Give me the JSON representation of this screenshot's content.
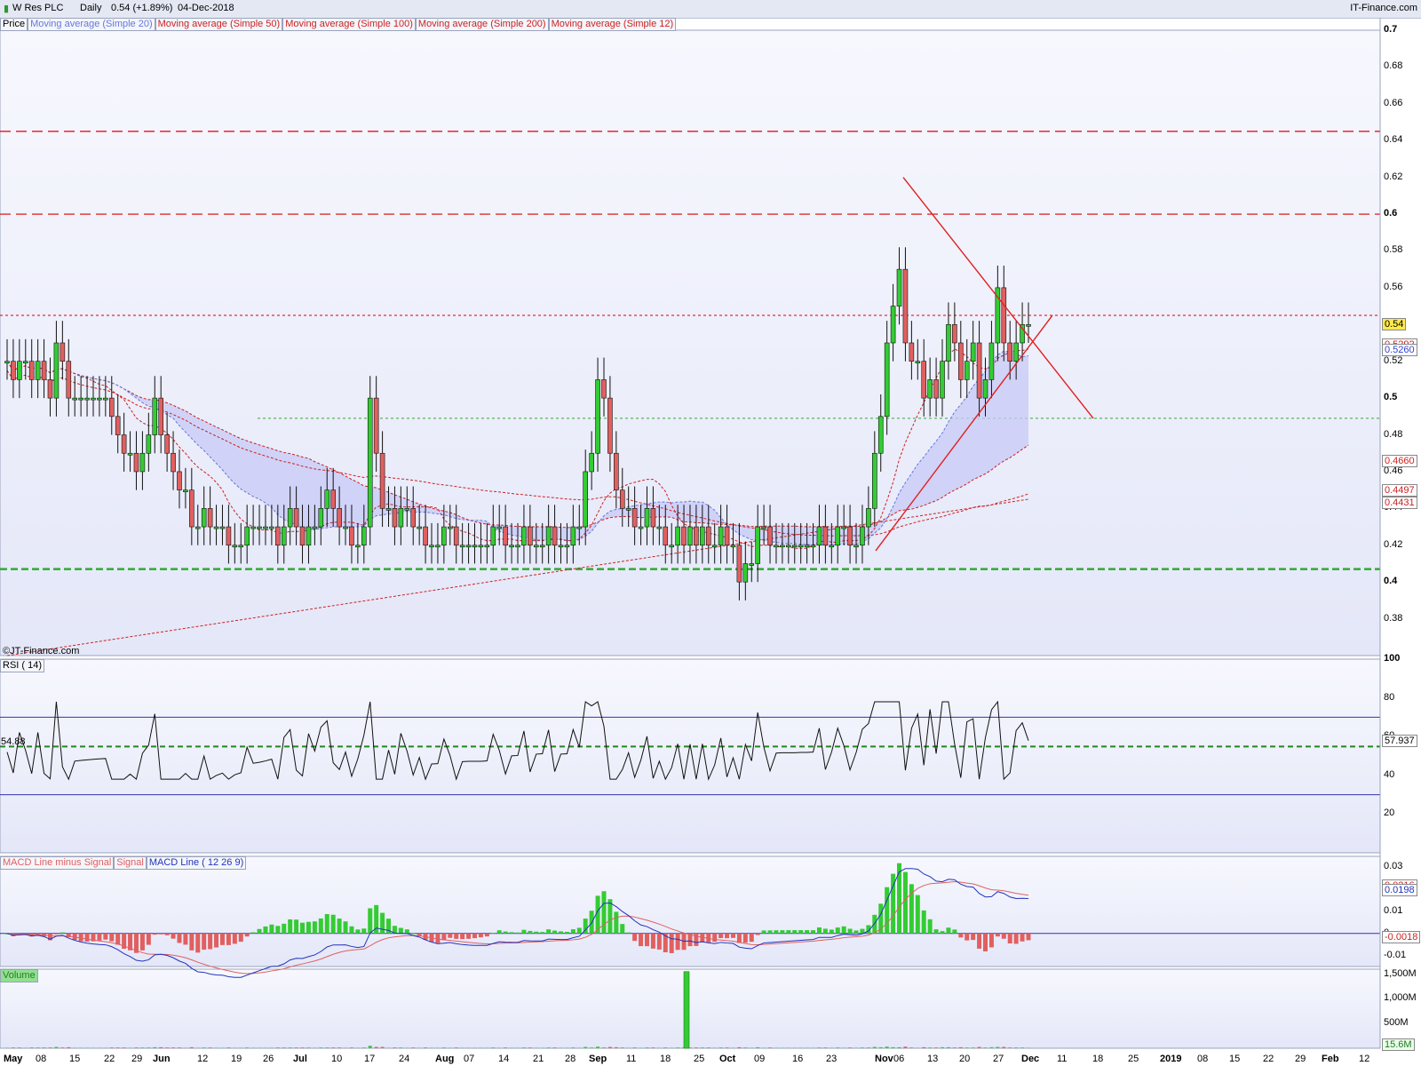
{
  "header": {
    "ticker": "W Res PLC",
    "period": "Daily",
    "quote": "0.54 (+1.89%)",
    "date": "04-Dec-2018",
    "brand": "IT-Finance.com"
  },
  "watermark": "©JT-Finance.com",
  "price_panel": {
    "legend": [
      "Price",
      "Moving average (Simple 20)",
      "Moving average (Simple 50)",
      "Moving average (Simple 100)",
      "Moving average (Simple 200)",
      "Moving average (Simple 12)"
    ],
    "y_ticks": [
      "0.7",
      "0.68",
      "0.66",
      "0.64",
      "0.62",
      "0.6",
      "0.58",
      "0.56",
      "0.54",
      "0.52",
      "0.5",
      "0.48",
      "0.46",
      "0.44",
      "0.42",
      "0.4",
      "0.38"
    ],
    "tags": [
      "0.54",
      "0.5292",
      "0.5260",
      "0.4660",
      "0.4497",
      "0.4431"
    ]
  },
  "rsi_panel": {
    "legend": "RSI ( 14)",
    "y_ticks": [
      "100",
      "80",
      "60",
      "40",
      "20"
    ],
    "left_value": "54.88",
    "tag": "57.937"
  },
  "macd_panel": {
    "legend": [
      "MACD Line minus Signal",
      "Signal",
      "MACD Line ( 12 26 9)"
    ],
    "y_ticks": [
      "0.03",
      "0.02",
      "0.01",
      "0",
      "-0.01"
    ],
    "tags": [
      "0.0216",
      "0.0198",
      "-0.0018"
    ]
  },
  "volume_panel": {
    "legend": "Volume",
    "y_ticks": [
      "1,500M",
      "1,000M",
      "500M"
    ],
    "tag": "15.6M"
  },
  "x_axis": [
    "May",
    "08",
    "15",
    "22",
    "29",
    "Jun",
    "12",
    "19",
    "26",
    "Jul",
    "10",
    "17",
    "24",
    "Aug",
    "07",
    "14",
    "21",
    "28",
    "Sep",
    "11",
    "18",
    "25",
    "Oct",
    "09",
    "16",
    "23",
    "Nov",
    "06",
    "13",
    "20",
    "27",
    "Dec",
    "11",
    "18",
    "25",
    "2019",
    "08",
    "15",
    "22",
    "29",
    "Feb",
    "12"
  ],
  "colors": {
    "up": "#33cc33",
    "down": "#e06060",
    "ma_red": "#cc2222",
    "ma_blue": "#6677dd",
    "fill_blue": "#c7c9f5",
    "fill_brown": "#c29a9a",
    "hline_red": "#dd0000",
    "hline_green": "#33aa33"
  },
  "chart_data": {
    "type": "candlestick",
    "series_hint": "daily OHLC, 04-May-2018 to 04-Dec-2018",
    "price_ylim": [
      0.36,
      0.7
    ],
    "horizontal_levels": {
      "red_dashed": [
        0.645,
        0.6,
        0.545
      ],
      "green_dashed": [
        0.489,
        0.407
      ]
    },
    "trendlines": [
      {
        "from": [
          "Nov 12",
          0.62
        ],
        "to": [
          "Dec 24",
          0.489
        ]
      },
      {
        "from": [
          "Nov 01",
          0.417
        ],
        "to": [
          "Dec 14",
          0.545
        ]
      }
    ],
    "closes": [
      0.52,
      0.51,
      0.52,
      0.52,
      0.51,
      0.52,
      0.51,
      0.5,
      0.53,
      0.52,
      0.5,
      0.5,
      0.5,
      0.5,
      0.5,
      0.5,
      0.5,
      0.49,
      0.48,
      0.47,
      0.47,
      0.46,
      0.47,
      0.48,
      0.5,
      0.48,
      0.47,
      0.46,
      0.45,
      0.45,
      0.43,
      0.43,
      0.44,
      0.43,
      0.43,
      0.43,
      0.42,
      0.42,
      0.42,
      0.43,
      0.43,
      0.43,
      0.43,
      0.43,
      0.42,
      0.43,
      0.44,
      0.43,
      0.42,
      0.43,
      0.43,
      0.44,
      0.45,
      0.44,
      0.43,
      0.43,
      0.42,
      0.42,
      0.43,
      0.5,
      0.47,
      0.44,
      0.44,
      0.43,
      0.44,
      0.44,
      0.43,
      0.43,
      0.42,
      0.42,
      0.42,
      0.43,
      0.43,
      0.42,
      0.42,
      0.42,
      0.42,
      0.42,
      0.42,
      0.43,
      0.43,
      0.42,
      0.42,
      0.42,
      0.43,
      0.42,
      0.42,
      0.42,
      0.43,
      0.42,
      0.42,
      0.42,
      0.43,
      0.43,
      0.46,
      0.47,
      0.51,
      0.5,
      0.47,
      0.45,
      0.44,
      0.44,
      0.43,
      0.43,
      0.44,
      0.43,
      0.43,
      0.42,
      0.42,
      0.43,
      0.42,
      0.43,
      0.42,
      0.43,
      0.42,
      0.42,
      0.43,
      0.42,
      0.42,
      0.4,
      0.41,
      0.41,
      0.43,
      0.43,
      0.42,
      0.42,
      0.42,
      0.42,
      0.42,
      0.42,
      0.42,
      0.42,
      0.43,
      0.42,
      0.42,
      0.43,
      0.43,
      0.42,
      0.42,
      0.43,
      0.44,
      0.47,
      0.49,
      0.53,
      0.55,
      0.57,
      0.53,
      0.52,
      0.52,
      0.5,
      0.51,
      0.5,
      0.52,
      0.54,
      0.53,
      0.51,
      0.52,
      0.53,
      0.5,
      0.51,
      0.53,
      0.56,
      0.53,
      0.52,
      0.53,
      0.54,
      0.54
    ],
    "volume_ylim": [
      0,
      1600000000
    ],
    "volume_spike": {
      "date": "Sep 24",
      "value": 1550000000
    },
    "rsi_ylim": [
      0,
      100
    ],
    "rsi_levels": [
      70,
      30
    ],
    "rsi_last": 57.937,
    "macd_ylim": [
      -0.015,
      0.035
    ],
    "macd_last": {
      "macd": 0.0198,
      "signal": 0.0216,
      "hist": -0.0018
    }
  }
}
